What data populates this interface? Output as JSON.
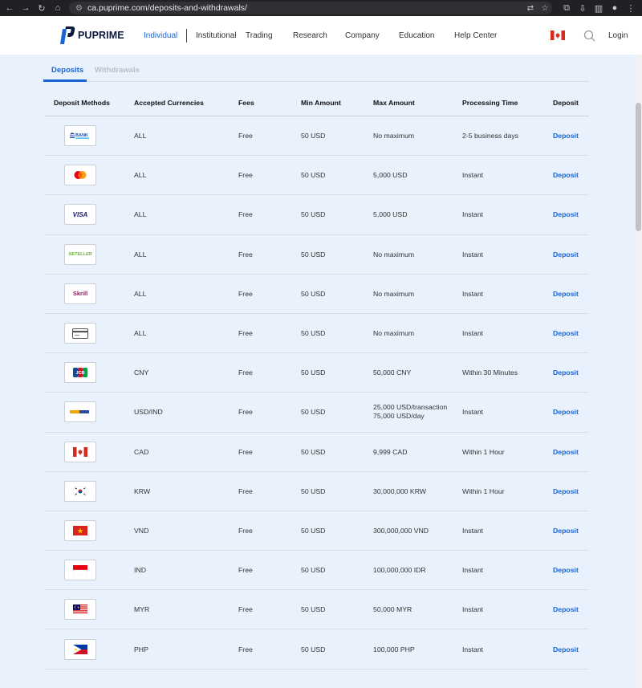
{
  "browser": {
    "url": "ca.puprime.com/deposits-and-withdrawals/"
  },
  "header": {
    "brand": "PUPRIME",
    "nav": [
      "Individual",
      "Institutional",
      "Trading",
      "Research",
      "Company",
      "Education",
      "Help Center"
    ],
    "active_nav": "Individual",
    "login": "Login"
  },
  "tabs": {
    "deposits": "Deposits",
    "withdrawals": "Withdrawals"
  },
  "table": {
    "headers": {
      "method": "Deposit Methods",
      "currencies": "Accepted Currencies",
      "fees": "Fees",
      "min": "Min Amount",
      "max": "Max Amount",
      "processing": "Processing Time",
      "deposit": "Deposit"
    },
    "rows": [
      {
        "icon": "bank-transfer-icon",
        "logo_text": "BANK",
        "currencies": "ALL",
        "fees": "Free",
        "min": "50 USD",
        "max": "No maximum",
        "processing": "2-5 business days",
        "action": "Deposit"
      },
      {
        "icon": "mastercard-icon",
        "currencies": "ALL",
        "fees": "Free",
        "min": "50 USD",
        "max": "5,000 USD",
        "processing": "Instant",
        "action": "Deposit"
      },
      {
        "icon": "visa-icon",
        "logo_text": "VISA",
        "currencies": "ALL",
        "fees": "Free",
        "min": "50 USD",
        "max": "5,000 USD",
        "processing": "Instant",
        "action": "Deposit"
      },
      {
        "icon": "neteller-icon",
        "logo_text": "NETELLER",
        "currencies": "ALL",
        "fees": "Free",
        "min": "50 USD",
        "max": "No maximum",
        "processing": "Instant",
        "action": "Deposit"
      },
      {
        "icon": "skrill-icon",
        "logo_text": "Skrill",
        "currencies": "ALL",
        "fees": "Free",
        "min": "50 USD",
        "max": "No maximum",
        "processing": "Instant",
        "action": "Deposit"
      },
      {
        "icon": "credit-card-icon",
        "currencies": "ALL",
        "fees": "Free",
        "min": "50 USD",
        "max": "No maximum",
        "processing": "Instant",
        "action": "Deposit"
      },
      {
        "icon": "jcb-icon",
        "logo_text": "JCB",
        "currencies": "CNY",
        "fees": "Free",
        "min": "50 USD",
        "max": "50,000 CNY",
        "processing": "Within 30 Minutes",
        "action": "Deposit"
      },
      {
        "icon": "payment-provider-icon",
        "currencies": "USD/IND",
        "fees": "Free",
        "min": "50 USD",
        "max_lines": [
          "25,000 USD/transaction",
          "75,000 USD/day"
        ],
        "processing": "Instant",
        "action": "Deposit"
      },
      {
        "icon": "canada-flag-icon",
        "currencies": "CAD",
        "fees": "Free",
        "min": "50 USD",
        "max": "9,999 CAD",
        "processing": "Within 1 Hour",
        "action": "Deposit"
      },
      {
        "icon": "south-korea-flag-icon",
        "currencies": "KRW",
        "fees": "Free",
        "min": "50 USD",
        "max": "30,000,000 KRW",
        "processing": "Within 1 Hour",
        "action": "Deposit"
      },
      {
        "icon": "vietnam-flag-icon",
        "currencies": "VND",
        "fees": "Free",
        "min": "50 USD",
        "max": "300,000,000 VND",
        "processing": "Instant",
        "action": "Deposit"
      },
      {
        "icon": "indonesia-flag-icon",
        "currencies": "IND",
        "fees": "Free",
        "min": "50 USD",
        "max": "100,000,000 IDR",
        "processing": "Instant",
        "action": "Deposit"
      },
      {
        "icon": "malaysia-flag-icon",
        "currencies": "MYR",
        "fees": "Free",
        "min": "50 USD",
        "max": "50,000 MYR",
        "processing": "Instant",
        "action": "Deposit"
      },
      {
        "icon": "philippines-flag-icon",
        "currencies": "PHP",
        "fees": "Free",
        "min": "50 USD",
        "max": "100,000 PHP",
        "processing": "Instant",
        "action": "Deposit"
      }
    ]
  },
  "colors": {
    "accent": "#1a64d6",
    "page_bg": "#e9f1fc",
    "brand_dark": "#0c1a3e"
  }
}
